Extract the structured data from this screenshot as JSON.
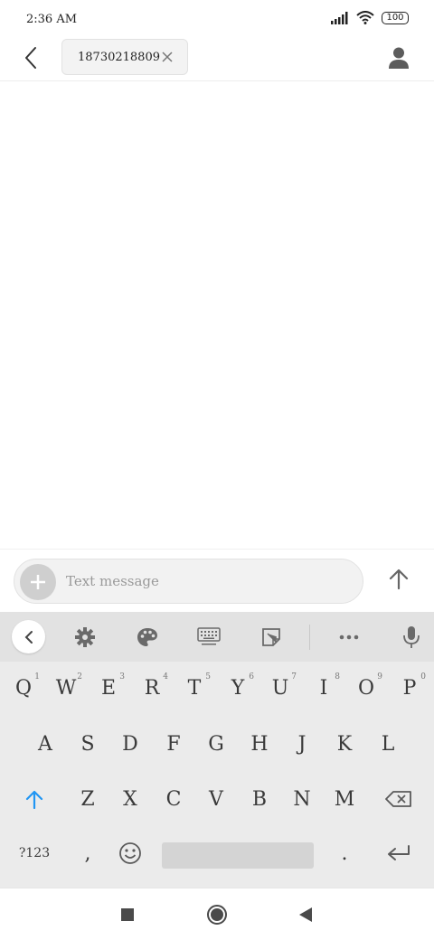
{
  "status_bar": {
    "time": "2:36 AM",
    "battery": "100",
    "icons": [
      "signal-icon",
      "wifi-icon",
      "battery-icon"
    ]
  },
  "header": {
    "recipient": "18730218809",
    "back_icon": "chevron-left-icon",
    "remove_icon": "close-icon",
    "contact_icon": "person-icon"
  },
  "compose": {
    "placeholder": "Text message",
    "attach_icon": "plus-icon",
    "send_icon": "arrow-up-icon"
  },
  "keyboard": {
    "toolbar": [
      "collapse-icon",
      "gear-icon",
      "palette-icon",
      "keyboard-icon",
      "clipboard-icon",
      "more-icon",
      "microphone-icon"
    ],
    "row1": [
      {
        "key": "Q",
        "hint": "1"
      },
      {
        "key": "W",
        "hint": "2"
      },
      {
        "key": "E",
        "hint": "3"
      },
      {
        "key": "R",
        "hint": "4"
      },
      {
        "key": "T",
        "hint": "5"
      },
      {
        "key": "Y",
        "hint": "6"
      },
      {
        "key": "U",
        "hint": "7"
      },
      {
        "key": "I",
        "hint": "8"
      },
      {
        "key": "O",
        "hint": "9"
      },
      {
        "key": "P",
        "hint": "0"
      }
    ],
    "row2": [
      "A",
      "S",
      "D",
      "F",
      "G",
      "H",
      "J",
      "K",
      "L"
    ],
    "row3": [
      "Z",
      "X",
      "C",
      "V",
      "B",
      "N",
      "M"
    ],
    "row4": {
      "symbols": "?123",
      "comma": ",",
      "period": "."
    },
    "accent_color": "#2196f3"
  },
  "nav_bar": {
    "icons": [
      "recents-square-icon",
      "home-circle-icon",
      "back-triangle-icon"
    ]
  }
}
